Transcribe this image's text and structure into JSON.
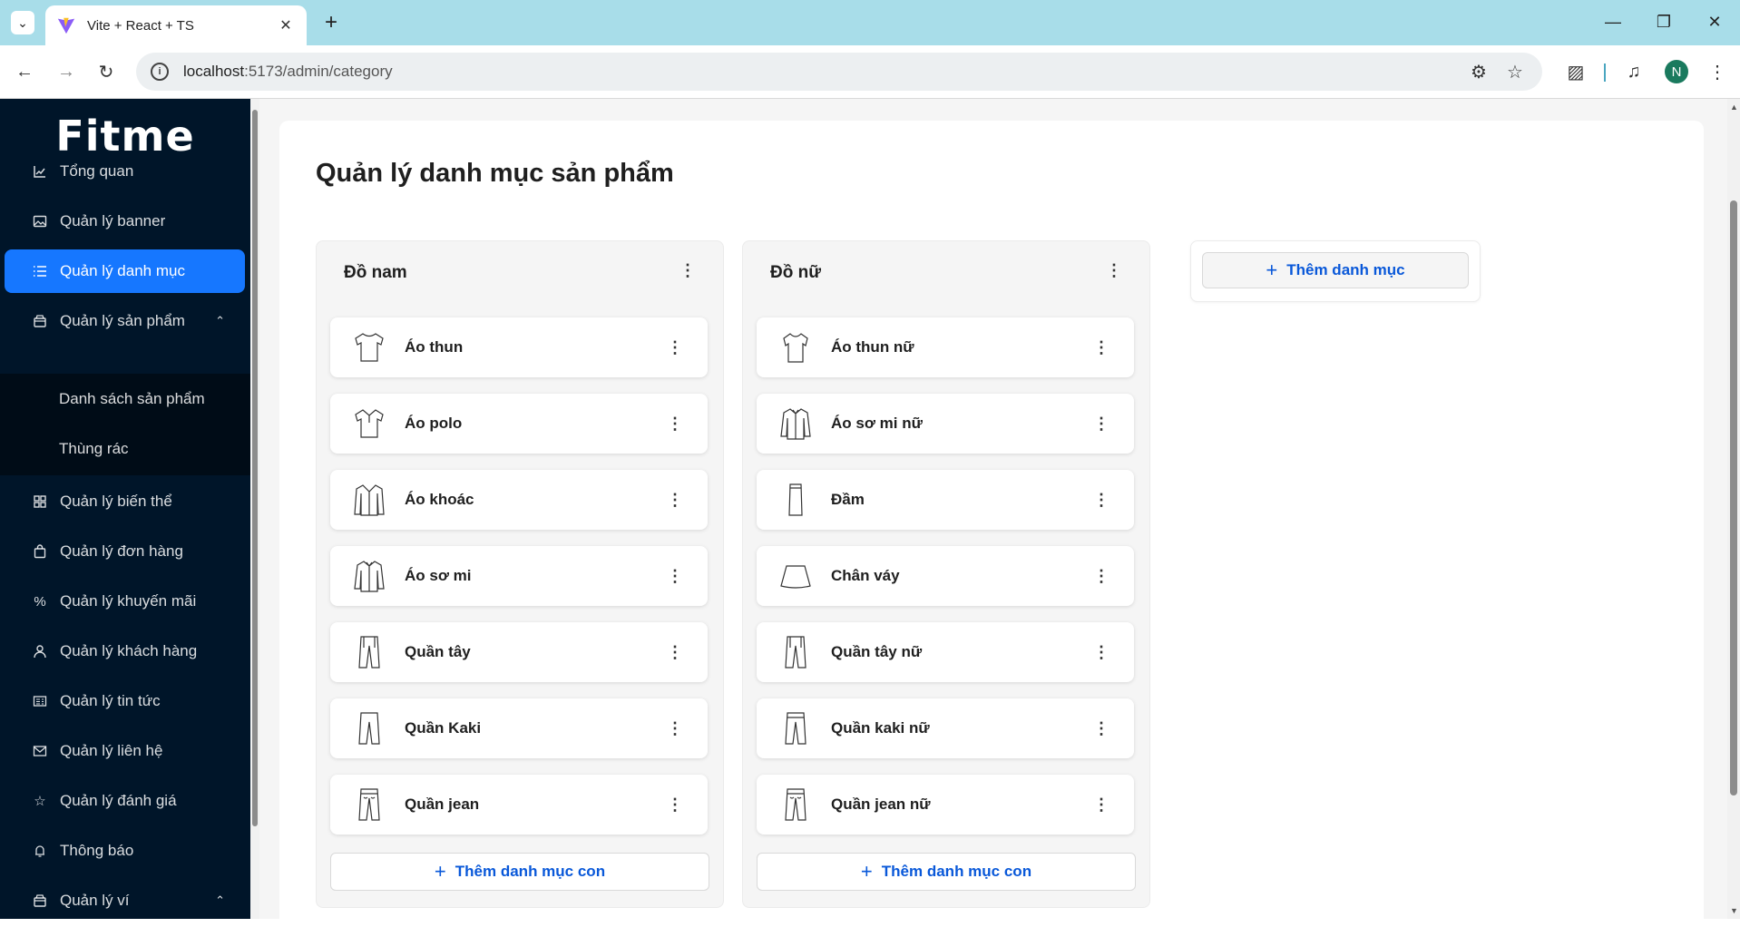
{
  "browser": {
    "tab_title": "Vite + React + TS",
    "url_host": "localhost",
    "url_path": ":5173/admin/category",
    "profile_initial": "N"
  },
  "sidebar": {
    "logo": "Fitme",
    "items": [
      {
        "label": "Tổng quan",
        "icon": "chart-icon"
      },
      {
        "label": "Quản lý banner",
        "icon": "image-icon"
      },
      {
        "label": "Quản lý danh mục",
        "icon": "list-icon",
        "active": true
      },
      {
        "label": "Quản lý sản phẩm",
        "icon": "box-icon",
        "expanded": true
      },
      {
        "label": "Quản lý biến thể",
        "icon": "grid-icon"
      },
      {
        "label": "Quản lý đơn hàng",
        "icon": "bag-icon"
      },
      {
        "label": "Quản lý khuyến mãi",
        "icon": "percent-icon"
      },
      {
        "label": "Quản lý khách hàng",
        "icon": "user-icon"
      },
      {
        "label": "Quản lý tin tức",
        "icon": "news-icon"
      },
      {
        "label": "Quản lý liên hệ",
        "icon": "mail-icon"
      },
      {
        "label": "Quản lý đánh giá",
        "icon": "star-icon"
      },
      {
        "label": "Thông báo",
        "icon": "bell-icon"
      },
      {
        "label": "Quản lý ví",
        "icon": "wallet-icon",
        "expanded": true
      }
    ],
    "sub_items": [
      "Danh sách sản phẩm",
      "Thùng rác"
    ]
  },
  "main": {
    "title": "Quản lý danh mục sản phẩm",
    "columns": [
      {
        "title": "Đồ nam",
        "items": [
          "Áo thun",
          "Áo polo",
          "Áo khoác",
          "Áo sơ mi",
          "Quần tây",
          "Quần Kaki",
          "Quần jean"
        ],
        "add_label": "Thêm danh mục con"
      },
      {
        "title": "Đồ nữ",
        "items": [
          "Áo thun nữ",
          "Áo sơ mi nữ",
          "Đầm",
          "Chân váy",
          "Quần tây nữ",
          "Quần kaki nữ",
          "Quần jean nữ"
        ],
        "add_label": "Thêm danh mục con"
      }
    ],
    "add_category_label": "Thêm danh mục"
  },
  "colors": {
    "sidebar_bg": "#001529",
    "active_bg": "#1677ff",
    "link_blue": "#0958d9",
    "tabbar_bg": "#a8dde9"
  }
}
